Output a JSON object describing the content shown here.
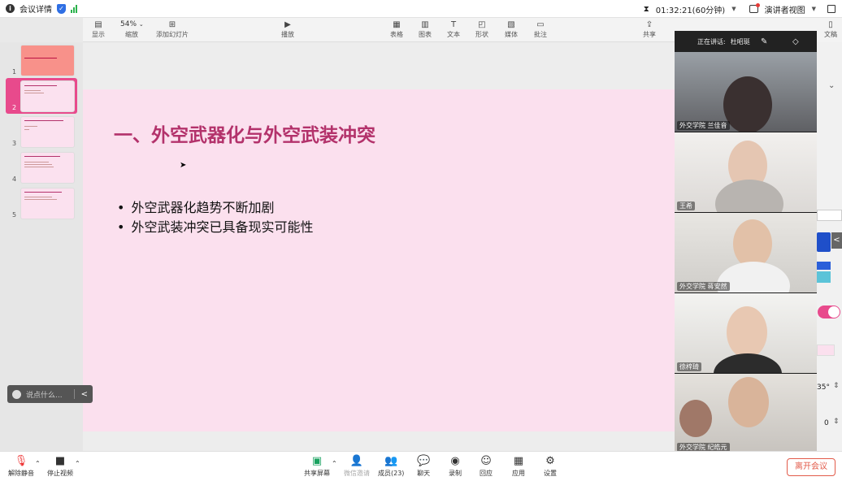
{
  "topbar": {
    "meeting_details": "会议详情",
    "timer": "01:32:21(60分钟)",
    "view_mode": "演讲者视图"
  },
  "toolbar": {
    "items": [
      {
        "label": "显示",
        "icon": "sidebar-icon"
      },
      {
        "label": "54%",
        "icon": "zoom-level"
      },
      {
        "label": "缩放",
        "icon": "zoom-icon"
      },
      {
        "label": "添加幻灯片",
        "icon": "add-slide-icon"
      },
      {
        "label": "播放",
        "icon": "play-icon"
      },
      {
        "label": "表格",
        "icon": "table-icon"
      },
      {
        "label": "图表",
        "icon": "chart-icon"
      },
      {
        "label": "文本",
        "icon": "text-icon"
      },
      {
        "label": "形状",
        "icon": "shape-icon"
      },
      {
        "label": "媒体",
        "icon": "media-icon"
      },
      {
        "label": "批注",
        "icon": "comment-icon"
      },
      {
        "label": "共享",
        "icon": "share-icon"
      },
      {
        "label": "文稿",
        "icon": "document-icon"
      }
    ]
  },
  "thumbnails": [
    "1",
    "2",
    "3",
    "4",
    "5"
  ],
  "chat": {
    "placeholder": "说点什么..."
  },
  "slide": {
    "title": "一、外空武器化与外空武装冲突",
    "bullets": [
      "外空武器化趋势不断加剧",
      "外空武装冲突已具备现实可能性"
    ]
  },
  "video_panel": {
    "speaking_label": "正在讲话:",
    "speaker": "杜昭珽",
    "participants": [
      "外交学院 兰佳音",
      "王希",
      "外交学院 蒋安然",
      "徐梓琦",
      "外交学院 纪皓元"
    ]
  },
  "right_panel": {
    "angle": "35°",
    "value": "0"
  },
  "bottombar": {
    "buttons": [
      {
        "label": "解除静音",
        "icon": "mic-muted-icon"
      },
      {
        "label": "停止视频",
        "icon": "camera-icon"
      },
      {
        "label": "共享屏幕",
        "icon": "share-screen-icon"
      },
      {
        "label": "微信邀请",
        "icon": "wechat-invite-icon"
      },
      {
        "label": "成员(23)",
        "icon": "members-icon"
      },
      {
        "label": "聊天",
        "icon": "chat-icon"
      },
      {
        "label": "录制",
        "icon": "record-icon"
      },
      {
        "label": "回应",
        "icon": "reaction-icon"
      },
      {
        "label": "应用",
        "icon": "apps-icon"
      },
      {
        "label": "设置",
        "icon": "settings-icon"
      }
    ],
    "leave": "离开会议"
  }
}
